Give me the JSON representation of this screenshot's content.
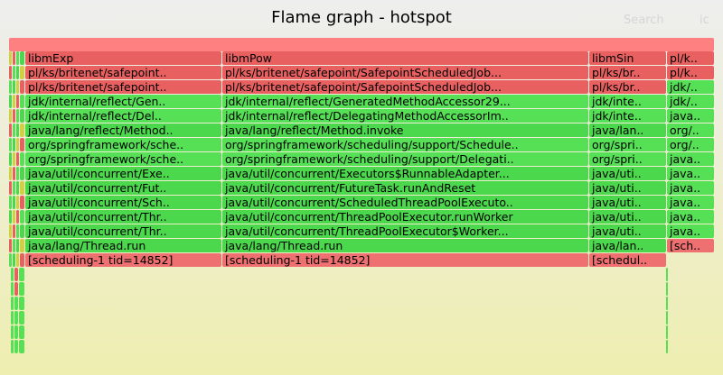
{
  "header": {
    "title": "Flame graph - hotspot",
    "search_label": "Search",
    "ic_label": "ic"
  },
  "colors": {
    "root": "#ff8080",
    "native": "#e86060",
    "java": "#55e055",
    "java_dark": "#4cd84c",
    "thread": "#ef7070"
  },
  "rows": [
    {
      "frames": [
        {
          "label": "libmExp",
          "col": "a",
          "color": "native"
        },
        {
          "label": "libmPow",
          "col": "b",
          "color": "native"
        },
        {
          "label": "libmSin",
          "col": "c",
          "color": "native"
        },
        {
          "label": "pl/k..",
          "col": "d",
          "color": "native"
        }
      ]
    },
    {
      "frames": [
        {
          "label": "pl/ks/britenet/safepoint..",
          "col": "a",
          "color": "native"
        },
        {
          "label": "pl/ks/britenet/safepoint/SafepointScheduledJob...",
          "col": "b",
          "color": "native"
        },
        {
          "label": "pl/ks/br..",
          "col": "c",
          "color": "native"
        },
        {
          "label": "pl/k..",
          "col": "d",
          "color": "native"
        }
      ]
    },
    {
      "frames": [
        {
          "label": "pl/ks/britenet/safepoint..",
          "col": "a",
          "color": "native"
        },
        {
          "label": "pl/ks/britenet/safepoint/SafepointScheduledJob...",
          "col": "b",
          "color": "native"
        },
        {
          "label": "pl/ks/br..",
          "col": "c",
          "color": "native"
        },
        {
          "label": "jdk/..",
          "col": "d",
          "color": "java"
        }
      ]
    },
    {
      "frames": [
        {
          "label": "jdk/internal/reflect/Gen..",
          "col": "a",
          "color": "java"
        },
        {
          "label": "jdk/internal/reflect/GeneratedMethodAccessor29...",
          "col": "b",
          "color": "java"
        },
        {
          "label": "jdk/inte..",
          "col": "c",
          "color": "java"
        },
        {
          "label": "jdk/..",
          "col": "d",
          "color": "java"
        }
      ]
    },
    {
      "frames": [
        {
          "label": "jdk/internal/reflect/Del..",
          "col": "a",
          "color": "java"
        },
        {
          "label": "jdk/internal/reflect/DelegatingMethodAccessorIm..",
          "col": "b",
          "color": "java"
        },
        {
          "label": "jdk/inte..",
          "col": "c",
          "color": "java"
        },
        {
          "label": "java..",
          "col": "d",
          "color": "java"
        }
      ]
    },
    {
      "frames": [
        {
          "label": "java/lang/reflect/Method..",
          "col": "a",
          "color": "java_dark"
        },
        {
          "label": "java/lang/reflect/Method.invoke",
          "col": "b",
          "color": "java_dark"
        },
        {
          "label": "java/lan..",
          "col": "c",
          "color": "java_dark"
        },
        {
          "label": "org/..",
          "col": "d",
          "color": "java"
        }
      ]
    },
    {
      "frames": [
        {
          "label": "org/springframework/sche..",
          "col": "a",
          "color": "java"
        },
        {
          "label": "org/springframework/scheduling/support/Schedule..",
          "col": "b",
          "color": "java"
        },
        {
          "label": "org/spri..",
          "col": "c",
          "color": "java"
        },
        {
          "label": "org/..",
          "col": "d",
          "color": "java"
        }
      ]
    },
    {
      "frames": [
        {
          "label": "org/springframework/sche..",
          "col": "a",
          "color": "java"
        },
        {
          "label": "org/springframework/scheduling/support/Delegati..",
          "col": "b",
          "color": "java"
        },
        {
          "label": "org/spri..",
          "col": "c",
          "color": "java"
        },
        {
          "label": "java..",
          "col": "d",
          "color": "java"
        }
      ]
    },
    {
      "frames": [
        {
          "label": "java/util/concurrent/Exe..",
          "col": "a",
          "color": "java_dark"
        },
        {
          "label": "java/util/concurrent/Executors$RunnableAdapter...",
          "col": "b",
          "color": "java_dark"
        },
        {
          "label": "java/uti..",
          "col": "c",
          "color": "java_dark"
        },
        {
          "label": "java..",
          "col": "d",
          "color": "java"
        }
      ]
    },
    {
      "frames": [
        {
          "label": "java/util/concurrent/Fut..",
          "col": "a",
          "color": "java_dark"
        },
        {
          "label": "java/util/concurrent/FutureTask.runAndReset",
          "col": "b",
          "color": "java_dark"
        },
        {
          "label": "java/uti..",
          "col": "c",
          "color": "java_dark"
        },
        {
          "label": "java..",
          "col": "d",
          "color": "java"
        }
      ]
    },
    {
      "frames": [
        {
          "label": "java/util/concurrent/Sch..",
          "col": "a",
          "color": "java_dark"
        },
        {
          "label": "java/util/concurrent/ScheduledThreadPoolExecuto..",
          "col": "b",
          "color": "java_dark"
        },
        {
          "label": "java/uti..",
          "col": "c",
          "color": "java_dark"
        },
        {
          "label": "java..",
          "col": "d",
          "color": "java"
        }
      ]
    },
    {
      "frames": [
        {
          "label": "java/util/concurrent/Thr..",
          "col": "a",
          "color": "java_dark"
        },
        {
          "label": "java/util/concurrent/ThreadPoolExecutor.runWorker",
          "col": "b",
          "color": "java_dark"
        },
        {
          "label": "java/uti..",
          "col": "c",
          "color": "java_dark"
        },
        {
          "label": "java..",
          "col": "d",
          "color": "java"
        }
      ]
    },
    {
      "frames": [
        {
          "label": "java/util/concurrent/Thr..",
          "col": "a",
          "color": "java_dark"
        },
        {
          "label": "java/util/concurrent/ThreadPoolExecutor$Worker...",
          "col": "b",
          "color": "java_dark"
        },
        {
          "label": "java/uti..",
          "col": "c",
          "color": "java_dark"
        },
        {
          "label": "java..",
          "col": "d",
          "color": "java"
        }
      ]
    },
    {
      "frames": [
        {
          "label": "java/lang/Thread.run",
          "col": "a",
          "color": "java_dark"
        },
        {
          "label": "java/lang/Thread.run",
          "col": "b",
          "color": "java_dark"
        },
        {
          "label": "java/lan..",
          "col": "c",
          "color": "java_dark"
        },
        {
          "label": "[sch..",
          "col": "d2",
          "color": "thread"
        }
      ]
    },
    {
      "frames": [
        {
          "label": "[scheduling-1 tid=14852]",
          "col": "a",
          "color": "thread"
        },
        {
          "label": "[scheduling-1 tid=14852]",
          "col": "b",
          "color": "thread"
        },
        {
          "label": "[schedul..",
          "col": "c",
          "color": "thread"
        }
      ]
    }
  ]
}
